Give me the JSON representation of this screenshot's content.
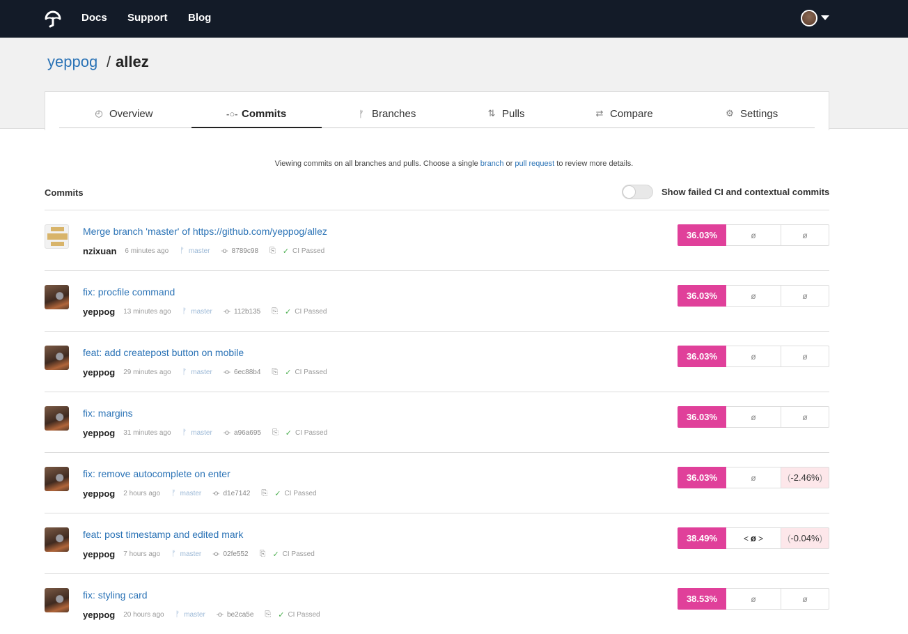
{
  "nav": {
    "links": [
      "Docs",
      "Support",
      "Blog"
    ]
  },
  "repo": {
    "owner": "yeppog",
    "separator": "/",
    "name": "allez"
  },
  "tabs": [
    {
      "label": "Overview",
      "icon": "gauge-icon"
    },
    {
      "label": "Commits",
      "icon": "commit-icon",
      "active": true
    },
    {
      "label": "Branches",
      "icon": "branch-icon"
    },
    {
      "label": "Pulls",
      "icon": "pull-icon"
    },
    {
      "label": "Compare",
      "icon": "compare-icon"
    },
    {
      "label": "Settings",
      "icon": "gear-icon"
    }
  ],
  "info": {
    "prefix": "Viewing commits on all branches and pulls. Choose a single ",
    "branch_link": "branch",
    "middle": " or ",
    "pull_link": "pull request",
    "suffix": " to review more details."
  },
  "section": {
    "title": "Commits",
    "toggle_label": "Show failed CI and contextual commits"
  },
  "commits": [
    {
      "message": "Merge branch 'master' of https://github.com/yeppog/allez",
      "author": "nzixuan",
      "time": "6 minutes ago",
      "branch": "master",
      "sha": "8789c98",
      "ci": "CI Passed",
      "coverage": "36.03%",
      "patch": "ø",
      "change": "ø"
    },
    {
      "message": "fix: procfile command",
      "author": "yeppog",
      "time": "13 minutes ago",
      "branch": "master",
      "sha": "112b135",
      "ci": "CI Passed",
      "coverage": "36.03%",
      "patch": "ø",
      "change": "ø"
    },
    {
      "message": "feat: add createpost button on mobile",
      "author": "yeppog",
      "time": "29 minutes ago",
      "branch": "master",
      "sha": "6ec88b4",
      "ci": "CI Passed",
      "coverage": "36.03%",
      "patch": "ø",
      "change": "ø"
    },
    {
      "message": "fix: margins",
      "author": "yeppog",
      "time": "31 minutes ago",
      "branch": "master",
      "sha": "a96a695",
      "ci": "CI Passed",
      "coverage": "36.03%",
      "patch": "ø",
      "change": "ø"
    },
    {
      "message": "fix: remove autocomplete on enter",
      "author": "yeppog",
      "time": "2 hours ago",
      "branch": "master",
      "sha": "d1e7142",
      "ci": "CI Passed",
      "coverage": "36.03%",
      "patch": "ø",
      "change": "-2.46%"
    },
    {
      "message": "feat: post timestamp and edited mark",
      "author": "yeppog",
      "time": "7 hours ago",
      "branch": "master",
      "sha": "02fe552",
      "ci": "CI Passed",
      "coverage": "38.49%",
      "patch": "ø",
      "change": "-0.04%"
    },
    {
      "message": "fix: styling card",
      "author": "yeppog",
      "time": "20 hours ago",
      "branch": "master",
      "sha": "be2ca5e",
      "ci": "CI Passed",
      "coverage": "38.53%",
      "patch": "ø",
      "change": "ø"
    }
  ],
  "colors": {
    "nav_bg": "#131b28",
    "link": "#2b73b6",
    "coverage": "#e0409a",
    "negative_bg": "#fde7ea",
    "ci_check": "#4caf50"
  }
}
